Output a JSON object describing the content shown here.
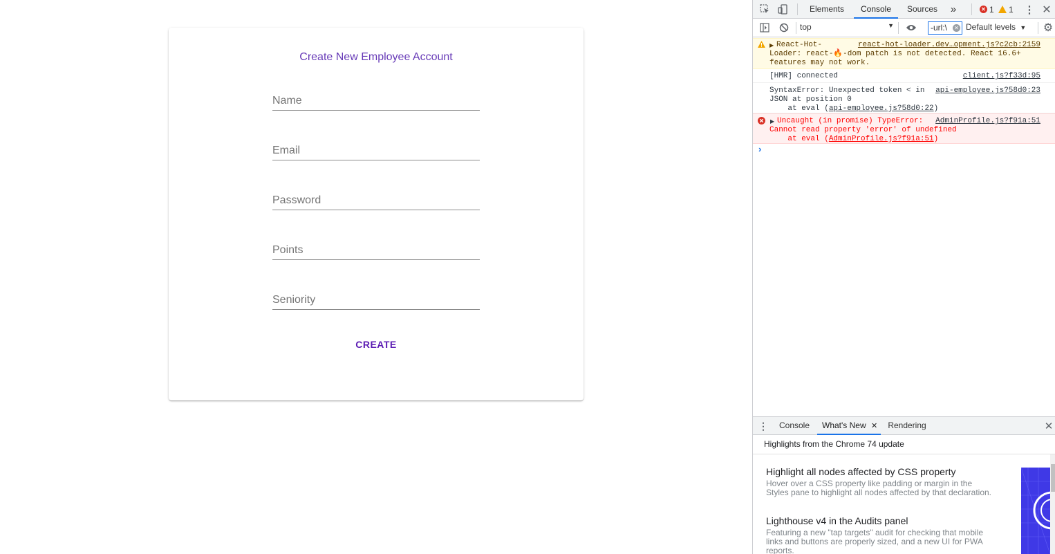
{
  "form": {
    "title": "Create New Employee Account",
    "fields": [
      {
        "placeholder": "Name",
        "value": ""
      },
      {
        "placeholder": "Email",
        "value": ""
      },
      {
        "placeholder": "Password",
        "value": ""
      },
      {
        "placeholder": "Points",
        "value": ""
      },
      {
        "placeholder": "Seniority",
        "value": ""
      }
    ],
    "submit_label": "CREATE"
  },
  "devtools": {
    "tabs": [
      "Elements",
      "Console",
      "Sources"
    ],
    "more_tabs": "»",
    "active_tab": "Console",
    "error_count": "1",
    "warning_count": "1",
    "context": "top",
    "filter_value": "-url:\\",
    "levels": "Default levels",
    "messages": [
      {
        "type": "warning",
        "lines": [
          "React-Hot-",
          "Loader: react-🔥-dom patch is not detected. React 16.6+",
          "features may not work."
        ],
        "source": "react-hot-loader.dev…opment.js?c2cb:2159"
      },
      {
        "type": "log",
        "lines": [
          "[HMR] connected"
        ],
        "source": "client.js?f33d:95"
      },
      {
        "type": "log",
        "lines": [
          "SyntaxError: Unexpected token < in",
          "JSON at position 0",
          "    at eval (",
          "api-employee.js?58d0:22",
          ")"
        ],
        "source": "api-employee.js?58d0:23"
      },
      {
        "type": "error",
        "lines": [
          "Uncaught (in promise) TypeError:",
          "Cannot read property 'error' of undefined",
          "    at eval (",
          "AdminProfile.js?f91a:51",
          ")"
        ],
        "source": "AdminProfile.js?f91a:51"
      }
    ],
    "prompt": "›",
    "drawer": {
      "tabs": [
        "Console",
        "What's New",
        "Rendering"
      ],
      "active_tab": "What's New",
      "subtitle": "Highlights from the Chrome 74 update",
      "items": [
        {
          "title": "Highlight all nodes affected by CSS property",
          "description": "Hover over a CSS property like padding or margin in the Styles pane to highlight all nodes affected by that declaration."
        },
        {
          "title": "Lighthouse v4 in the Audits panel",
          "description": "Featuring a new \"tap targets\" audit for checking that mobile links and buttons are properly sized, and a new UI for PWA reports."
        }
      ]
    }
  }
}
